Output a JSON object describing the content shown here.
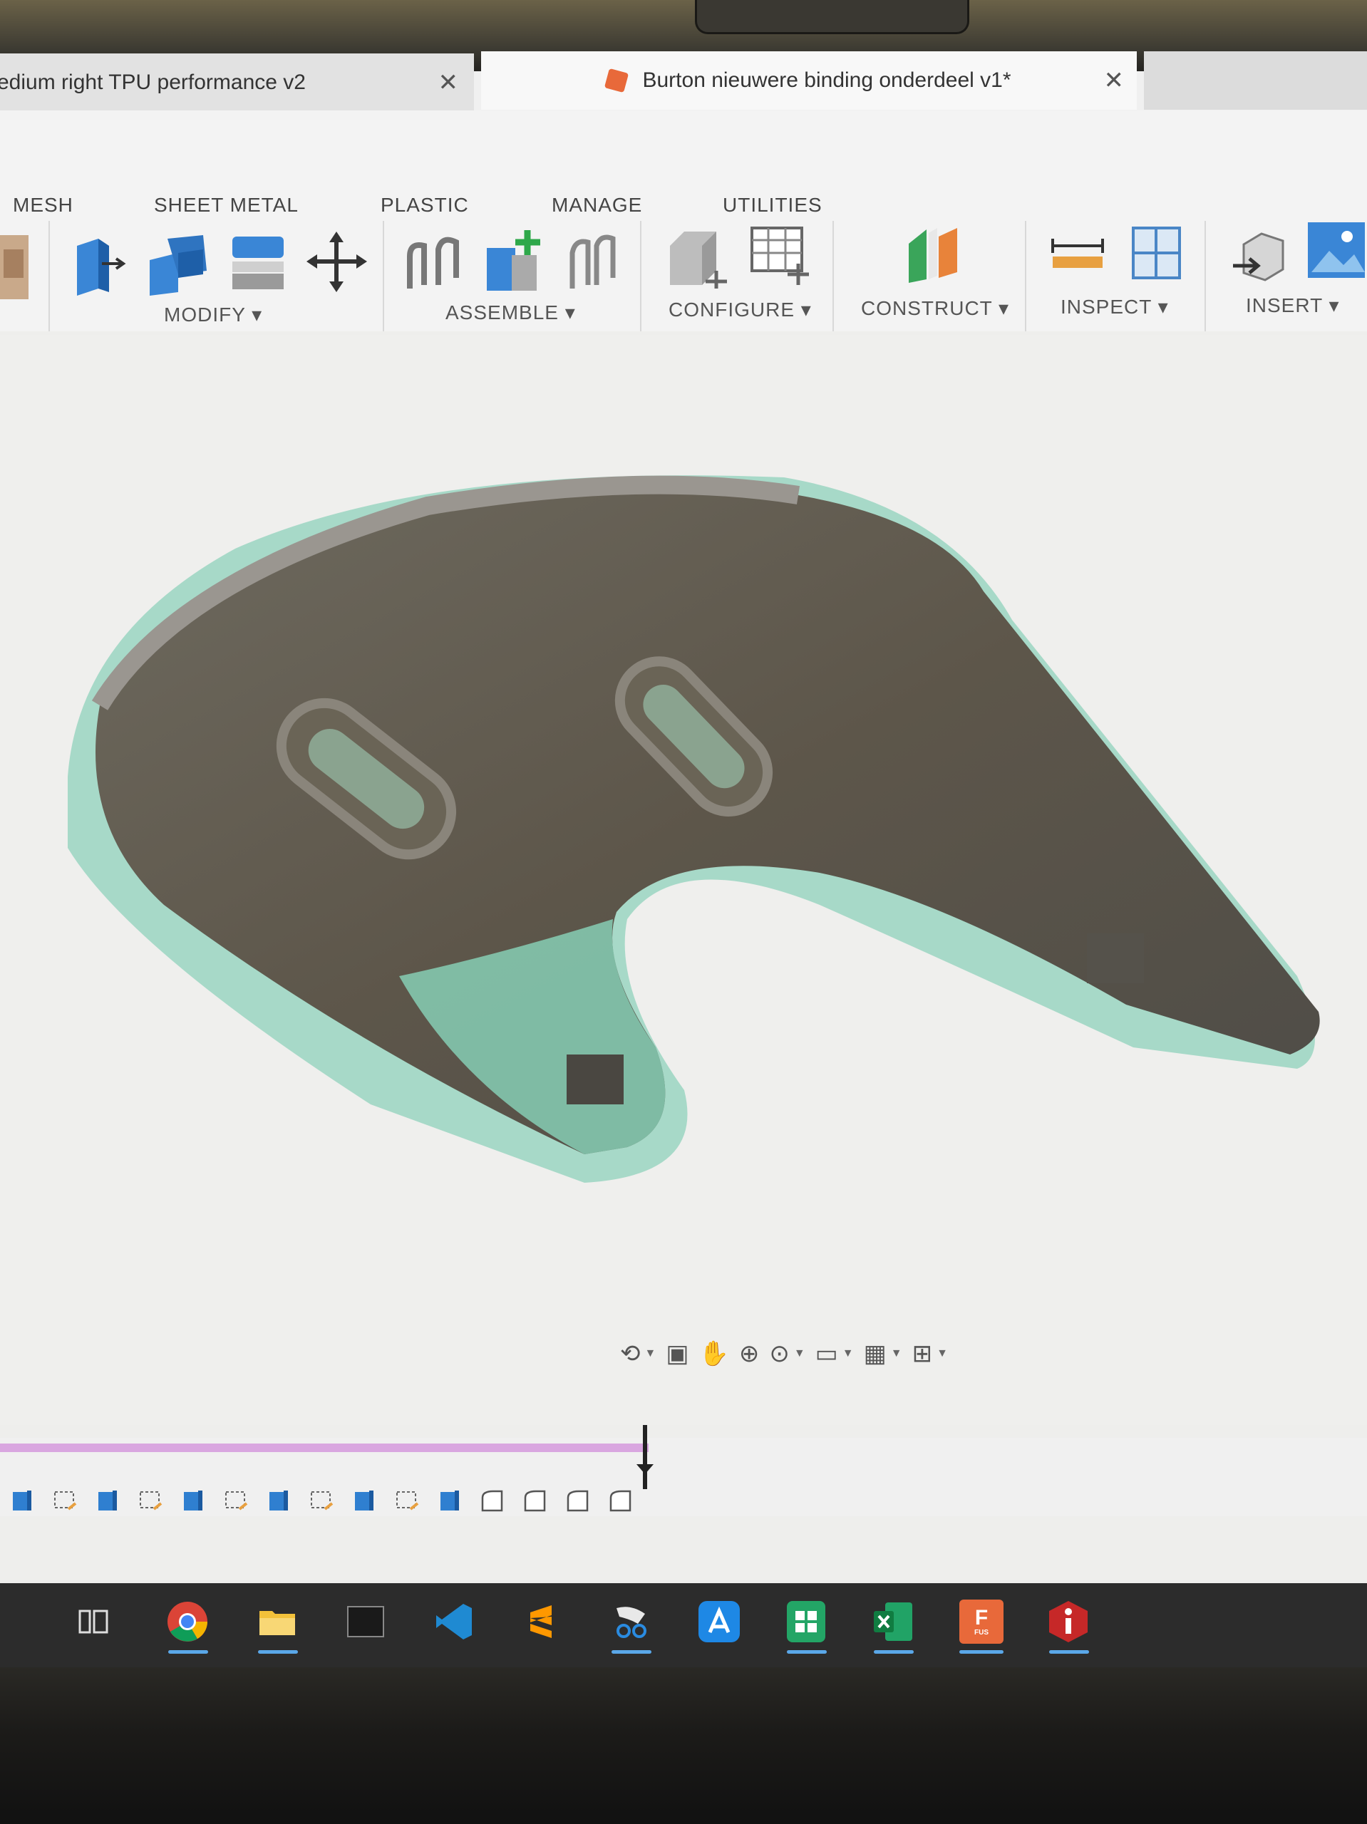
{
  "tabs": [
    {
      "label": "edium right TPU performance v2",
      "close": "✕",
      "active": false
    },
    {
      "label": "Burton nieuwere binding onderdeel v1*",
      "close": "✕",
      "active": true
    }
  ],
  "workspace_tabs": [
    "MESH",
    "SHEET METAL",
    "PLASTIC",
    "MANAGE",
    "UTILITIES"
  ],
  "tool_groups": [
    {
      "label": "MODIFY ▾"
    },
    {
      "label": "ASSEMBLE ▾"
    },
    {
      "label": "CONFIGURE ▾"
    },
    {
      "label": "CONSTRUCT ▾"
    },
    {
      "label": "INSPECT ▾"
    },
    {
      "label": "INSERT ▾"
    }
  ],
  "taskbar_apps": [
    "task-view",
    "chrome",
    "file-explorer",
    "terminal",
    "vscode",
    "sublime-text",
    "snipping-tool",
    "app-store",
    "google-sheets",
    "excel",
    "fusion-360",
    "info"
  ],
  "fusion_icon_text": {
    "letter": "F",
    "sub": "FUS"
  },
  "colors": {
    "accent": "#e8693a",
    "mesh": "#7fc7b0",
    "body": "#5a544a",
    "timeline": "#d9a6e0"
  }
}
